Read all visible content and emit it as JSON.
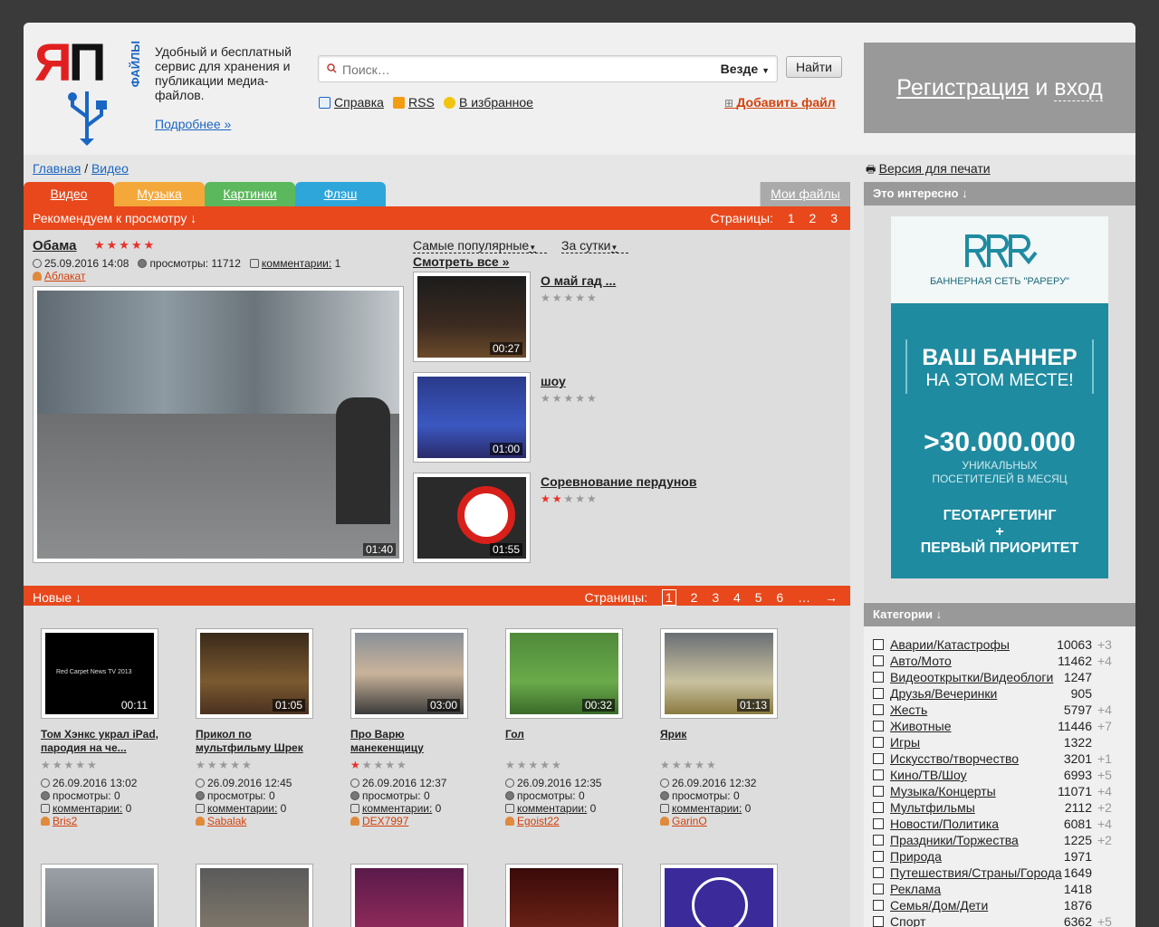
{
  "header": {
    "logo_ya": "ЯП",
    "logo_files": "ФАЙЛЫ",
    "tagline": "Удобный и бесплатный сервис для хранения и публикации медиа-файлов.",
    "more_link": "Подробнее »",
    "search_placeholder": "Поиск…",
    "search_scope": "Везде",
    "find_button": "Найти",
    "links": {
      "help": "Справка",
      "rss": "RSS",
      "favorites": "В избранное"
    },
    "add_file": "Добавить файл",
    "register": "Регистрация",
    "and": "и",
    "login": "вход"
  },
  "breadcrumb": {
    "home": "Главная",
    "sep": "/",
    "current": "Видео"
  },
  "print_link": "Версия для печати",
  "tabs": [
    {
      "label": "Видео",
      "color": "#e8481c"
    },
    {
      "label": "Музыка",
      "color": "#f4a83a"
    },
    {
      "label": "Картинки",
      "color": "#5cb85c"
    },
    {
      "label": "Флэш",
      "color": "#2fa6d9"
    }
  ],
  "my_files": "Мои файлы",
  "recommended": {
    "label": "Рекомендуем к просмотру ↓",
    "pages_label": "Страницы:",
    "pages": [
      "1",
      "2",
      "3"
    ]
  },
  "featured": {
    "title": "Обама",
    "rating": 5,
    "date": "25.09.2016 14:08",
    "views": "просмотры: 11712",
    "comments_label": "комментарии:",
    "comments": "1",
    "author": "Аблакат",
    "duration": "01:40"
  },
  "sort": {
    "popular": "Самые популярные",
    "period": "За сутки",
    "see_all": "Смотреть все »"
  },
  "side_videos": [
    {
      "title": "О май гад ...",
      "duration": "00:27",
      "rating": 0
    },
    {
      "title": "шоу",
      "duration": "01:00",
      "rating": 0
    },
    {
      "title": "Соревнование пердунов",
      "duration": "01:55",
      "rating": 2
    }
  ],
  "new_section": {
    "label": "Новые ↓",
    "pages_label": "Страницы:",
    "pages": [
      "1",
      "2",
      "3",
      "4",
      "5",
      "6",
      "…",
      "→"
    ],
    "current": "1"
  },
  "new_videos": [
    {
      "title": "Том Хэнкс украл iPad, пародия на че...",
      "duration": "00:11",
      "rating": 0,
      "date": "26.09.2016 13:02",
      "views": "просмотры: 0",
      "comments": "комментарии:",
      "comments_count": "0",
      "author": "Bris2",
      "thumb_text": "Red Carpet News TV 2013"
    },
    {
      "title": "Прикол по мультфильму Шрек",
      "duration": "01:05",
      "rating": 0,
      "date": "26.09.2016 12:45",
      "views": "просмотры: 0",
      "comments": "комментарии:",
      "comments_count": "0",
      "author": "Sabalak"
    },
    {
      "title": "Про Варю манекенщицу",
      "duration": "03:00",
      "rating": 1,
      "date": "26.09.2016 12:37",
      "views": "просмотры: 0",
      "comments": "комментарии:",
      "comments_count": "0",
      "author": "DEX7997"
    },
    {
      "title": "Гол",
      "duration": "00:32",
      "rating": 0,
      "date": "26.09.2016 12:35",
      "views": "просмотры: 0",
      "comments": "комментарии:",
      "comments_count": "0",
      "author": "Egoist22"
    },
    {
      "title": "Ярик",
      "duration": "01:13",
      "rating": 0,
      "date": "26.09.2016 12:32",
      "views": "просмотры: 0",
      "comments": "комментарии:",
      "comments_count": "0",
      "author": "GarinO"
    }
  ],
  "interesting": {
    "label": "Это интересно ↓",
    "banner_net": "БАННЕРНАЯ СЕТЬ \"РАРЕРУ\"",
    "banner_line1": "ВАШ БАННЕР",
    "banner_line2": "НА ЭТОМ МЕСТЕ!",
    "banner_num": ">30.000.000",
    "banner_uniq1": "УНИКАЛЬНЫХ",
    "banner_uniq2": "ПОСЕТИТЕЛЕЙ В МЕСЯЦ",
    "banner_geo": "ГЕОТАРГЕТИНГ",
    "banner_plus": "+",
    "banner_priority": "ПЕРВЫЙ ПРИОРИТЕТ"
  },
  "categories": {
    "label": "Категории ↓",
    "items": [
      {
        "name": "Аварии/Катастрофы",
        "count": "10063",
        "delta": "+3"
      },
      {
        "name": "Авто/Мото",
        "count": "11462",
        "delta": "+4"
      },
      {
        "name": "Видеооткрытки/Видеоблоги",
        "count": "1247",
        "delta": ""
      },
      {
        "name": "Друзья/Вечеринки",
        "count": "905",
        "delta": ""
      },
      {
        "name": "Жесть",
        "count": "5797",
        "delta": "+4"
      },
      {
        "name": "Животные",
        "count": "11446",
        "delta": "+7"
      },
      {
        "name": "Игры",
        "count": "1322",
        "delta": ""
      },
      {
        "name": "Искусство/творчество",
        "count": "3201",
        "delta": "+1"
      },
      {
        "name": "Кино/ТВ/Шоу",
        "count": "6993",
        "delta": "+5"
      },
      {
        "name": "Музыка/Концерты",
        "count": "11071",
        "delta": "+4"
      },
      {
        "name": "Мультфильмы",
        "count": "2112",
        "delta": "+2"
      },
      {
        "name": "Новости/Политика",
        "count": "6081",
        "delta": "+4"
      },
      {
        "name": "Праздники/Торжества",
        "count": "1225",
        "delta": "+2"
      },
      {
        "name": "Природа",
        "count": "1971",
        "delta": ""
      },
      {
        "name": "Путешествия/Страны/Города",
        "count": "1649",
        "delta": ""
      },
      {
        "name": "Реклама",
        "count": "1418",
        "delta": ""
      },
      {
        "name": "Семья/Дом/Дети",
        "count": "1876",
        "delta": ""
      },
      {
        "name": "Спорт",
        "count": "6362",
        "delta": "+5"
      }
    ]
  }
}
